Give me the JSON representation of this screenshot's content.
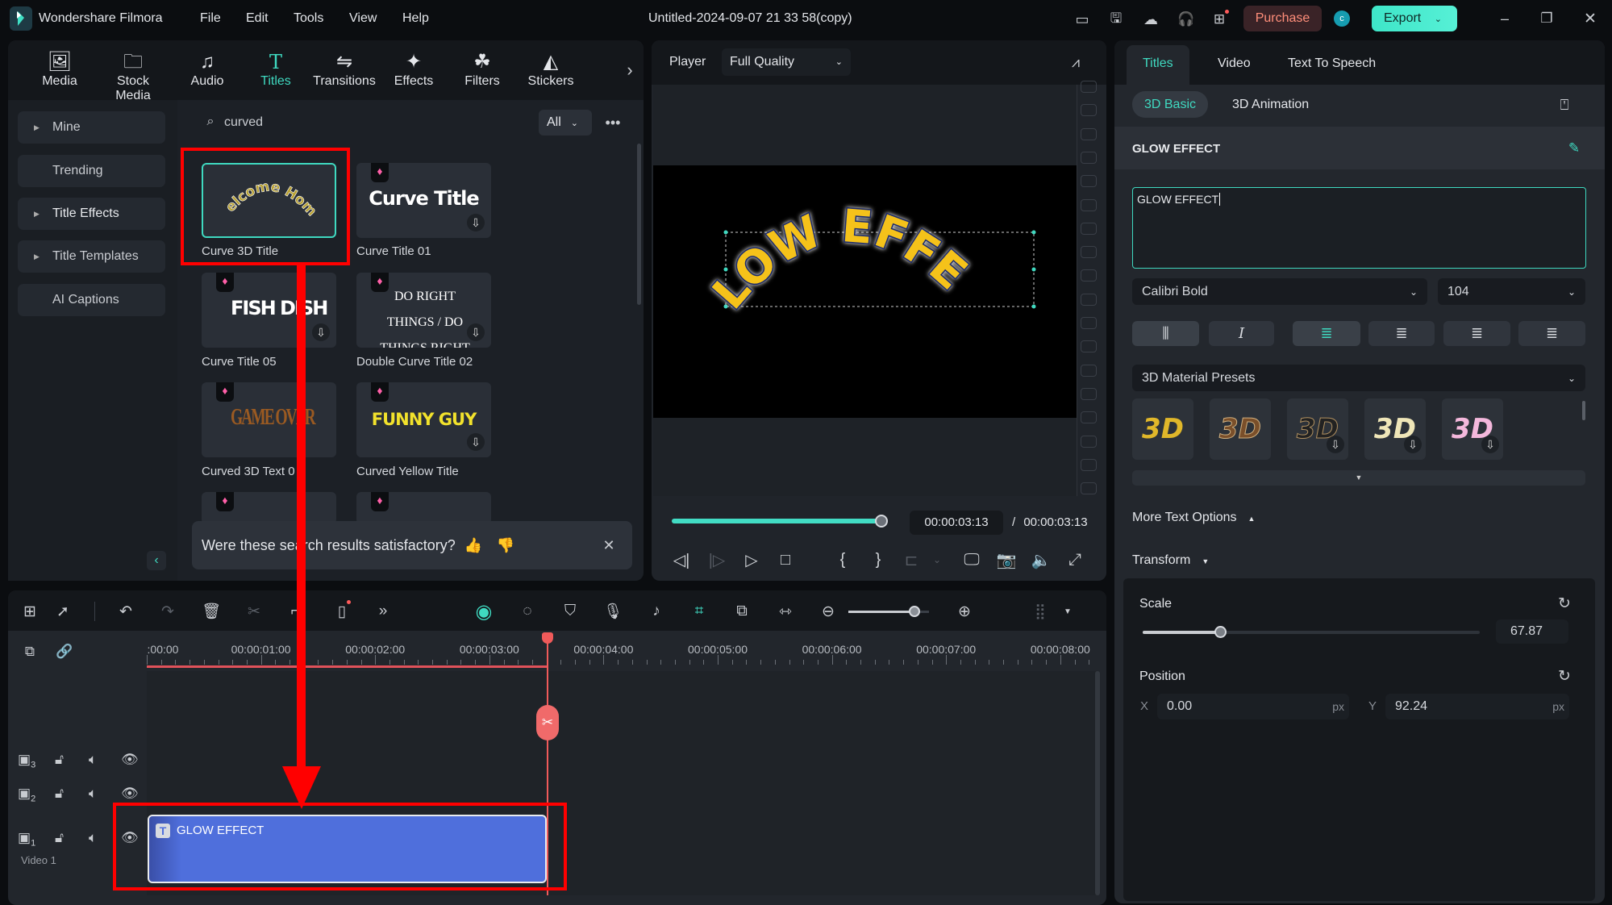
{
  "app": {
    "name": "Wondershare Filmora",
    "menu": [
      "File",
      "Edit",
      "Tools",
      "View",
      "Help"
    ],
    "project_title": "Untitled-2024-09-07 21 33 58(copy)",
    "purchase_label": "Purchase",
    "avatar_letter": "c",
    "export_label": "Export",
    "accent_color": "#3fd9c0"
  },
  "library": {
    "tabs": [
      {
        "label": "Media",
        "icon": "media-icon"
      },
      {
        "label": "Stock Media",
        "icon": "stock-media-icon"
      },
      {
        "label": "Audio",
        "icon": "music-note-icon"
      },
      {
        "label": "Titles",
        "icon": "titles-t-icon",
        "active": true
      },
      {
        "label": "Transitions",
        "icon": "transitions-icon"
      },
      {
        "label": "Effects",
        "icon": "effects-star-icon"
      },
      {
        "label": "Filters",
        "icon": "filters-icon"
      },
      {
        "label": "Stickers",
        "icon": "stickers-icon"
      }
    ],
    "sidebar": [
      {
        "label": "Mine",
        "expandable": true
      },
      {
        "label": "Trending",
        "expandable": false
      },
      {
        "label": "Title Effects",
        "expandable": true
      },
      {
        "label": "Title Templates",
        "expandable": true
      },
      {
        "label": "AI Captions",
        "expandable": false
      }
    ],
    "search": {
      "value": "curved",
      "filter": "All"
    },
    "results": [
      {
        "label": "Curve 3D Title",
        "preview": "Welcome Home",
        "selected": true
      },
      {
        "label": "Curve Title 01",
        "preview": "Curve Title",
        "premium": true
      },
      {
        "label": "Curve Title 05",
        "preview": "FISH DISH",
        "premium": true
      },
      {
        "label": "Double Curve Title 02",
        "preview": "DO RIGHT THINGS / DO THINGS RIGHT",
        "premium": true
      },
      {
        "label": "Curved 3D Text 0",
        "preview": "GAME OVER",
        "premium": true
      },
      {
        "label": "Curved Yellow Title",
        "preview": "FUNNY GUY",
        "premium": true
      }
    ],
    "feedback": "Were these search results satisfactory?"
  },
  "player": {
    "label": "Player",
    "quality": "Full Quality",
    "canvas_text": "GLOW EFFECT",
    "current_time": "00:00:03:13",
    "total_time": "/ 00:00:03:13",
    "progress": 1.0
  },
  "timeline": {
    "ruler": [
      ":00:00",
      "00:00:01:00",
      "00:00:02:00",
      "00:00:03:00",
      "00:00:04:00",
      "00:00:05:00",
      "00:00:06:00",
      "00:00:07:00",
      "00:00:08:00"
    ],
    "playhead_time": "00:00:03:13",
    "zoom_level": 0.82,
    "tracks": [
      {
        "num": "3"
      },
      {
        "num": "2"
      },
      {
        "num": "1",
        "name": "Video 1"
      }
    ],
    "clip": {
      "label": "GLOW EFFECT",
      "color": "#4f6fdc"
    }
  },
  "inspector": {
    "tabs": [
      "Titles",
      "Video",
      "Text To Speech"
    ],
    "subtabs": [
      "3D Basic",
      "3D Animation"
    ],
    "section_title": "GLOW EFFECT",
    "text_value": "GLOW EFFECT",
    "font": "Calibri Bold",
    "size": "104",
    "presets_label": "3D Material Presets",
    "preset_tiles": [
      "3D",
      "3D",
      "3D",
      "3D",
      "3D"
    ],
    "more_text_options": "More Text Options",
    "transform": "Transform",
    "scale_label": "Scale",
    "scale_value": "67.87",
    "scale_fraction": 0.23,
    "position_label": "Position",
    "x_label": "X",
    "x_value": "0.00",
    "y_label": "Y",
    "y_value": "92.24",
    "unit": "px"
  },
  "annotation": {
    "color": "#ff0000"
  }
}
